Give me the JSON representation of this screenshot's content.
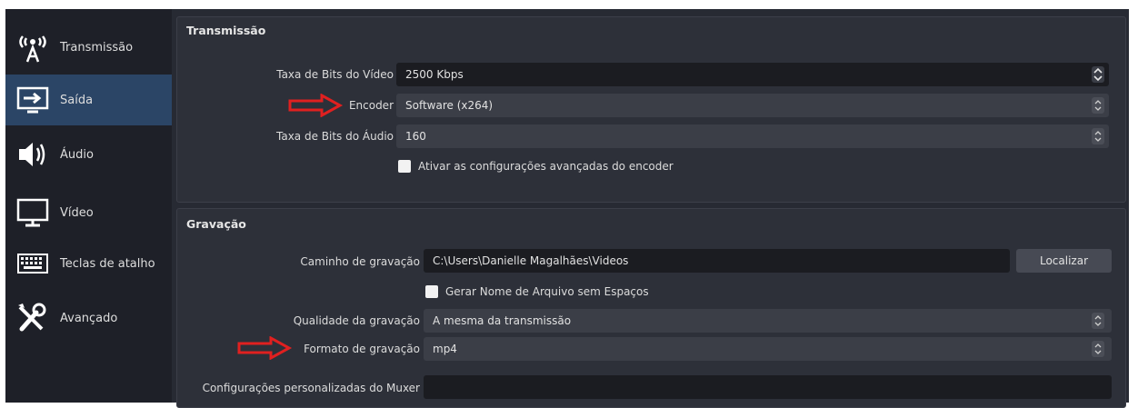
{
  "sidebar": {
    "items": [
      {
        "label": "Transmissão",
        "icon": "broadcast-icon"
      },
      {
        "label": "Saída",
        "icon": "output-icon"
      },
      {
        "label": "Áudio",
        "icon": "speaker-icon"
      },
      {
        "label": "Vídeo",
        "icon": "monitor-icon"
      },
      {
        "label": "Teclas de atalho",
        "icon": "keyboard-icon"
      },
      {
        "label": "Avançado",
        "icon": "tools-icon"
      }
    ],
    "active": "Saída"
  },
  "streaming": {
    "title": "Transmissão",
    "video_bitrate_label": "Taxa de Bits do Vídeo",
    "video_bitrate_value": "2500 Kbps",
    "encoder_label": "Encoder",
    "encoder_value": "Software (x264)",
    "audio_bitrate_label": "Taxa de Bits do Áudio",
    "audio_bitrate_value": "160",
    "advanced_encoder_label": "Ativar as configurações avançadas do encoder"
  },
  "recording": {
    "title": "Gravação",
    "path_label": "Caminho de gravação",
    "path_value": "C:\\Users\\Danielle Magalhães\\Videos",
    "browse_label": "Localizar",
    "no_space_label": "Gerar Nome de Arquivo sem Espaços",
    "quality_label": "Qualidade da gravação",
    "quality_value": "A mesma da transmissão",
    "format_label": "Formato de gravação",
    "format_value": "mp4",
    "muxer_label": "Configurações personalizadas do Muxer",
    "muxer_value": ""
  },
  "colors": {
    "annotation_arrow": "#e02020",
    "active_sidebar": "#2b4566"
  }
}
